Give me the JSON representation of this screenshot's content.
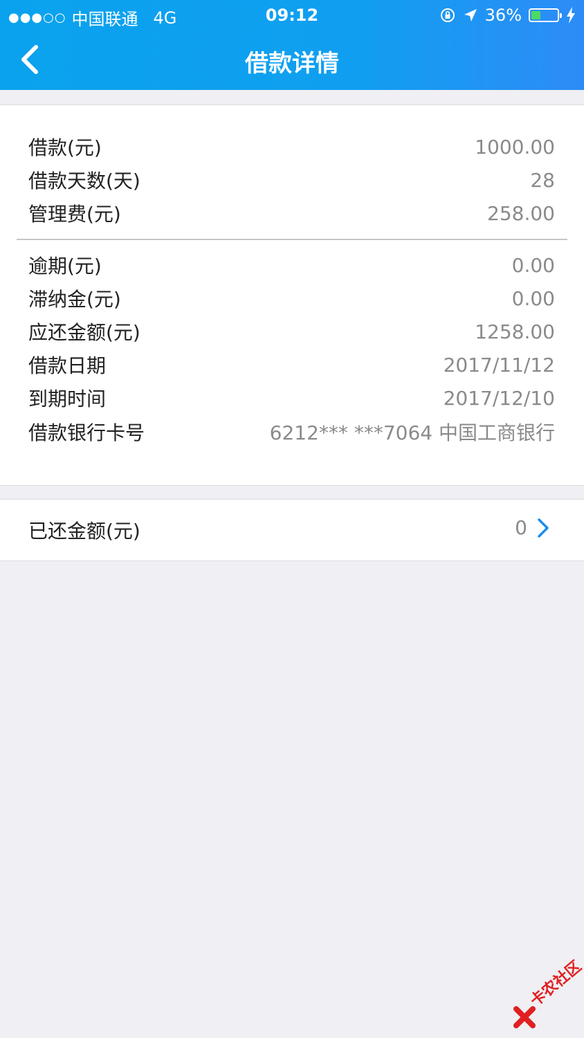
{
  "status": {
    "signal_dots": "●●●○○",
    "carrier": "中国联通",
    "network": "4G",
    "time": "09:12",
    "battery": "36%",
    "battery_level": 0.36
  },
  "navbar": {
    "title": "借款详情",
    "back_icon": "chevron-left-icon"
  },
  "details": [
    {
      "label": "借款(元)",
      "value": "1000.00"
    },
    {
      "label": "借款天数(天)",
      "value": "28"
    },
    {
      "label": "管理费(元)",
      "value": "258.00"
    },
    {
      "label": "逾期(元)",
      "value": "0.00"
    },
    {
      "label": "滞纳金(元)",
      "value": "0.00"
    },
    {
      "label": "应还金额(元)",
      "value": "1258.00"
    },
    {
      "label": "借款日期",
      "value": "2017/11/12"
    },
    {
      "label": "到期时间",
      "value": "2017/12/10"
    },
    {
      "label": "借款银行卡号",
      "value": "6212*** ***7064 中国工商银行"
    }
  ],
  "repaid": {
    "label": "已还金额(元)",
    "value": "0",
    "icon": "chevron-right-icon"
  },
  "watermark": {
    "text": "卡农社区"
  },
  "colors": {
    "header_start": "#0aa2ee",
    "header_end": "#2d8cf7",
    "accent": "#1a8cf0",
    "battery_fill": "#4cd964"
  }
}
